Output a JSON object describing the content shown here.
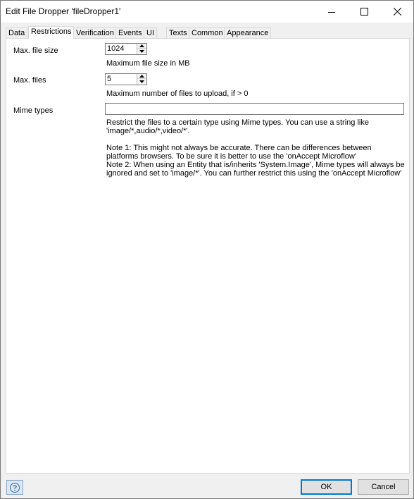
{
  "window": {
    "title": "Edit File Dropper 'fileDropper1'"
  },
  "tabs": [
    {
      "label": "Data",
      "active": false
    },
    {
      "label": "Restrictions",
      "active": true
    },
    {
      "label": "Verification",
      "active": false
    },
    {
      "label": "Events",
      "active": false
    },
    {
      "label": "UI",
      "active": false
    },
    {
      "label": "Texts",
      "active": false
    },
    {
      "label": "Common",
      "active": false
    },
    {
      "label": "Appearance",
      "active": false
    }
  ],
  "restrictions": {
    "max_file_size": {
      "label": "Max. file size",
      "value": "1024",
      "hint": "Maximum file size in MB"
    },
    "max_files": {
      "label": "Max. files",
      "value": "5",
      "hint": "Maximum number of files to upload, if > 0"
    },
    "mime_types": {
      "label": "Mime types",
      "value": "",
      "help_lines": [
        "Restrict the files to a certain type using Mime types. You can use a string like",
        "'image/*,audio/*,video/*'.",
        "",
        "Note 1: This might not always be accurate. There can be differences between",
        "platforms  browsers. To be sure it is better to use the 'onAccept Microflow'",
        "Note 2: When using an Entity that is/inherits 'System.Image', Mime types will always be",
        "ignored and set to 'image/*'. You can further restrict this using the 'onAccept Microflow'"
      ]
    }
  },
  "footer": {
    "ok_label": "OK",
    "cancel_label": "Cancel",
    "help_icon": "question-circle-icon"
  },
  "colors": {
    "accent": "#0078d7",
    "panel_bg": "#ffffff",
    "window_bg": "#f0f0f0"
  }
}
